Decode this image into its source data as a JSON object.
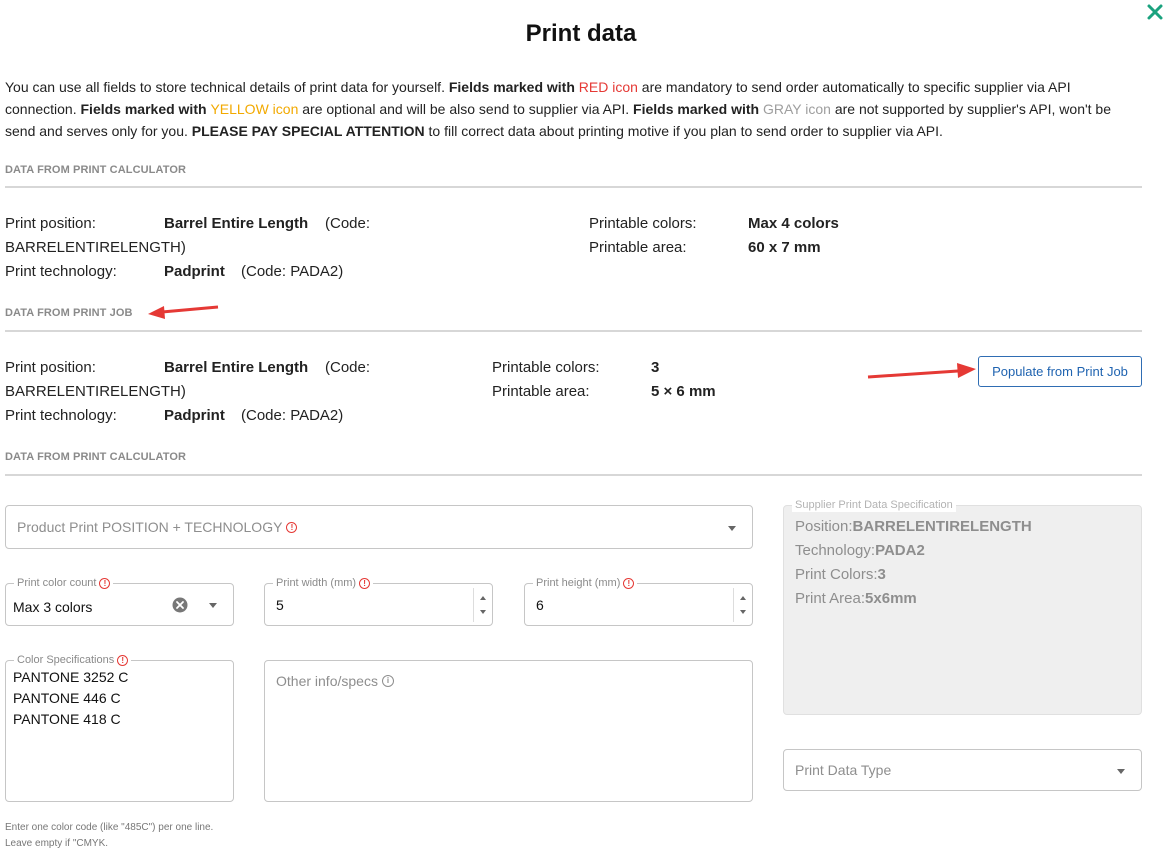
{
  "modal": {
    "title": "Print data",
    "close_icon": "close-icon",
    "accent_color": "#1aa27e"
  },
  "intro": {
    "t1": "You can use all fields to store technical details of print data for yourself. ",
    "b1": "Fields marked with ",
    "red": "RED icon",
    "t2": " are mandatory to send order automatically to specific supplier via API connection. ",
    "b2": "Fields marked with ",
    "yellow": "YELLOW icon",
    "t3": " are optional and will be also send to supplier via API. ",
    "b3": "Fields marked with ",
    "gray": "GRAY icon",
    "t4": " are not supported by supplier's API, won't be send and serves only for you. ",
    "b4": "PLEASE PAY SPECIAL ATTENTION",
    "t5": " to fill correct data about printing motive if you plan to send order to supplier via API."
  },
  "section_calc": {
    "heading": "DATA FROM PRINT CALCULATOR",
    "position_label": "Print position:",
    "position_value": "Barrel Entire Length",
    "position_code_a": "(Code:",
    "position_code_b": "BARRELENTIRELENGTH)",
    "technology_label": "Print technology:",
    "technology_value": "Padprint",
    "technology_code": "(Code: PADA2)",
    "colors_label": "Printable colors:",
    "colors_value": "Max 4 colors",
    "area_label": "Printable area:",
    "area_value": "60 x 7 mm"
  },
  "section_job": {
    "heading": "DATA FROM PRINT JOB",
    "position_label": "Print position:",
    "position_value": "Barrel Entire Length",
    "position_code_a": "(Code:",
    "position_code_b": "BARRELENTIRELENGTH)",
    "technology_label": "Print technology:",
    "technology_value": "Padprint",
    "technology_code": "(Code: PADA2)",
    "colors_label": "Printable colors:",
    "colors_value": "3",
    "area_label": "Printable area:",
    "area_value": "5 × 6 mm",
    "populate_button": "Populate from Print Job"
  },
  "section_form": {
    "heading": "DATA FROM PRINT CALCULATOR",
    "position_tech_placeholder": "Product Print POSITION + TECHNOLOGY",
    "color_count_label": "Print color count",
    "color_count_value": "Max 3 colors",
    "width_label": "Print width (mm)",
    "width_value": "5",
    "height_label": "Print height (mm)",
    "height_value": "6",
    "color_spec_label": "Color Specifications",
    "color_spec_lines": [
      "PANTONE 3252 C",
      "PANTONE 446 C",
      "PANTONE 418 C"
    ],
    "other_info_placeholder": "Other info/specs",
    "helper_text": "Enter one color code (like \"485C\") per one line. Leave empty if \"CMYK.",
    "print_data_type_placeholder": "Print Data Type"
  },
  "supplier_spec": {
    "label": "Supplier Print Data Specification",
    "position_label": "Position:",
    "position_value": "BARRELENTIRELENGTH",
    "technology_label": "Technology:",
    "technology_value": "PADA2",
    "colors_label": "Print Colors:",
    "colors_value": "3",
    "area_label": "Print Area:",
    "area_value": "5x6mm"
  }
}
